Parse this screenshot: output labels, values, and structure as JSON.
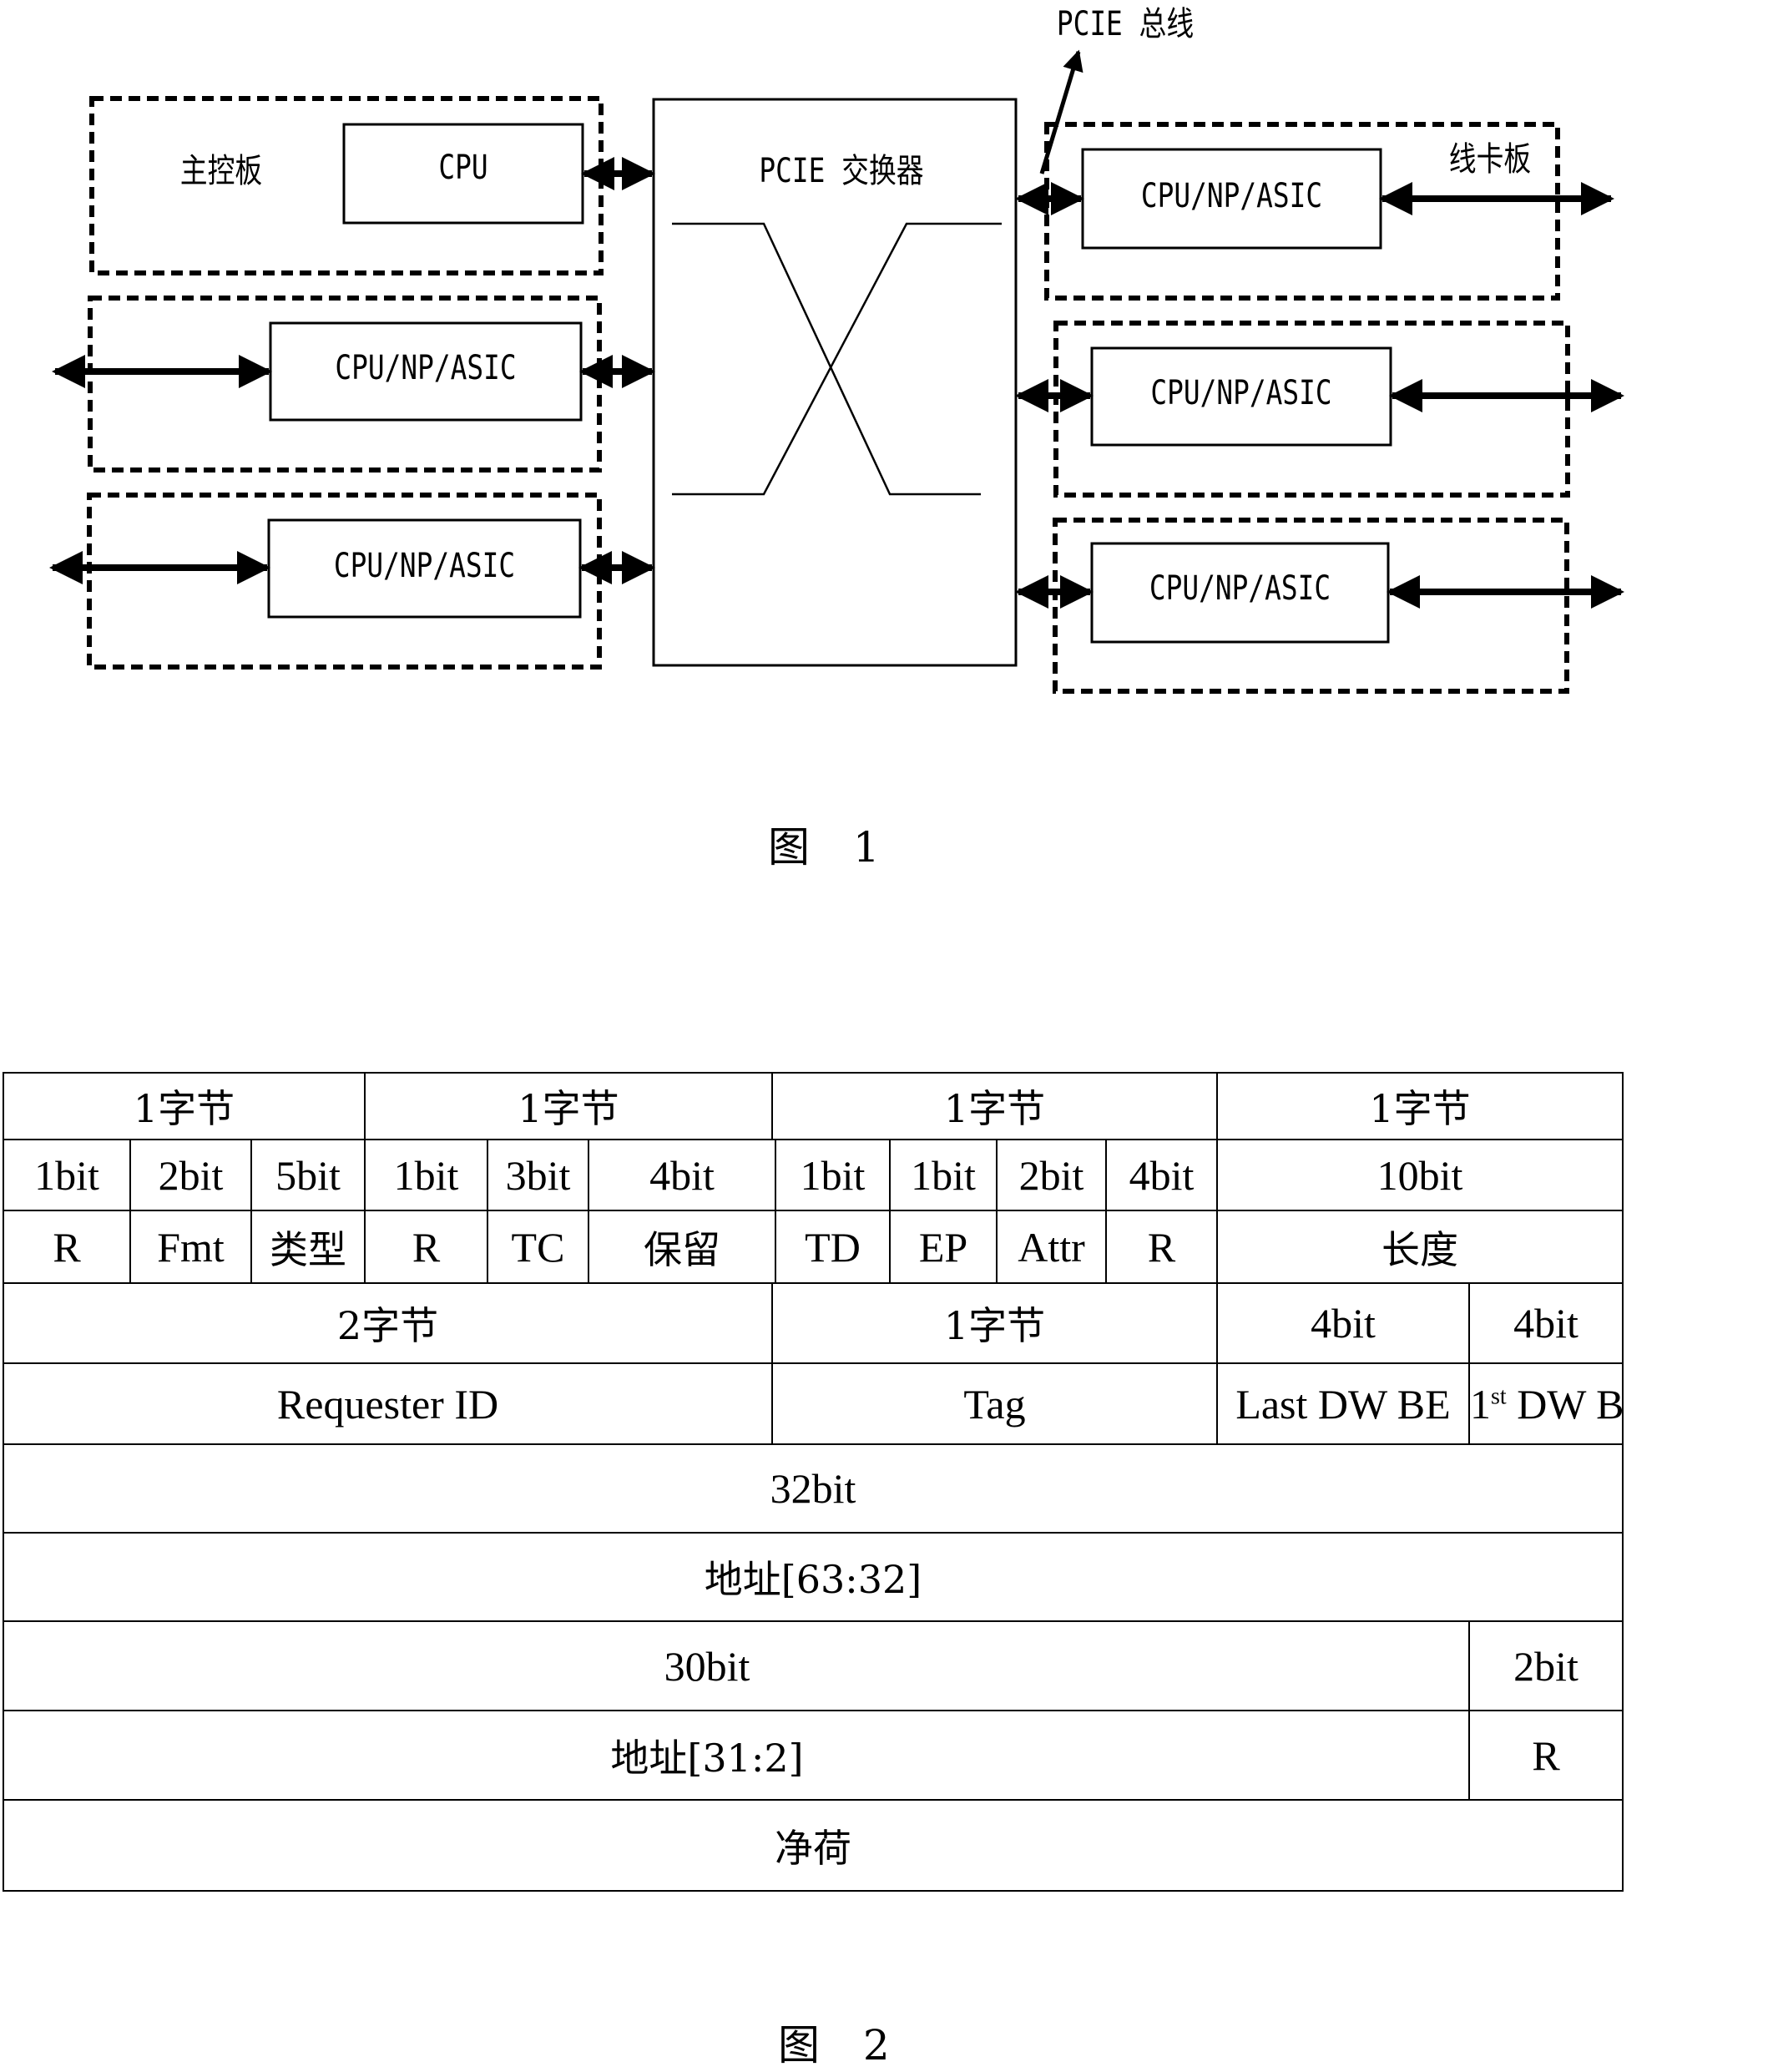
{
  "figure1": {
    "caption": "图 1",
    "bus_label": "PCIE 总线",
    "switch_label": "PCIE 交换器",
    "main_board": {
      "label": "主控板",
      "chip_label": "CPU"
    },
    "left_boards": [
      {
        "chip_label": "CPU/NP/ASIC"
      },
      {
        "chip_label": "CPU/NP/ASIC"
      }
    ],
    "line_card": {
      "label": "线卡板"
    },
    "right_boards": [
      {
        "chip_label": "CPU/NP/ASIC"
      },
      {
        "chip_label": "CPU/NP/ASIC"
      },
      {
        "chip_label": "CPU/NP/ASIC"
      }
    ]
  },
  "figure2": {
    "caption": "图 2",
    "rows": {
      "r1": [
        "1字节",
        "1字节",
        "1字节",
        "1字节"
      ],
      "r2": [
        "1bit",
        "2bit",
        "5bit",
        "1bit",
        "3bit",
        "4bit",
        "1bit",
        "1bit",
        "2bit",
        "4bit",
        "10bit"
      ],
      "r3": [
        "R",
        "Fmt",
        "类型",
        "R",
        "TC",
        "保留",
        "TD",
        "EP",
        "Attr",
        "R",
        "长度"
      ],
      "r4": [
        "2字节",
        "1字节",
        "4bit",
        "4bit"
      ],
      "r5": [
        "Requester ID",
        "Tag",
        "Last DW BE"
      ],
      "r5_first_dw": {
        "num": "1",
        "sup": "st",
        "rest": " DW BE"
      },
      "r6": [
        "32bit"
      ],
      "r7": [
        "地址[63:32]"
      ],
      "r8": [
        "30bit",
        "2bit"
      ],
      "r9": [
        "地址[31:2]",
        "R"
      ],
      "r10": [
        "净荷"
      ]
    }
  }
}
